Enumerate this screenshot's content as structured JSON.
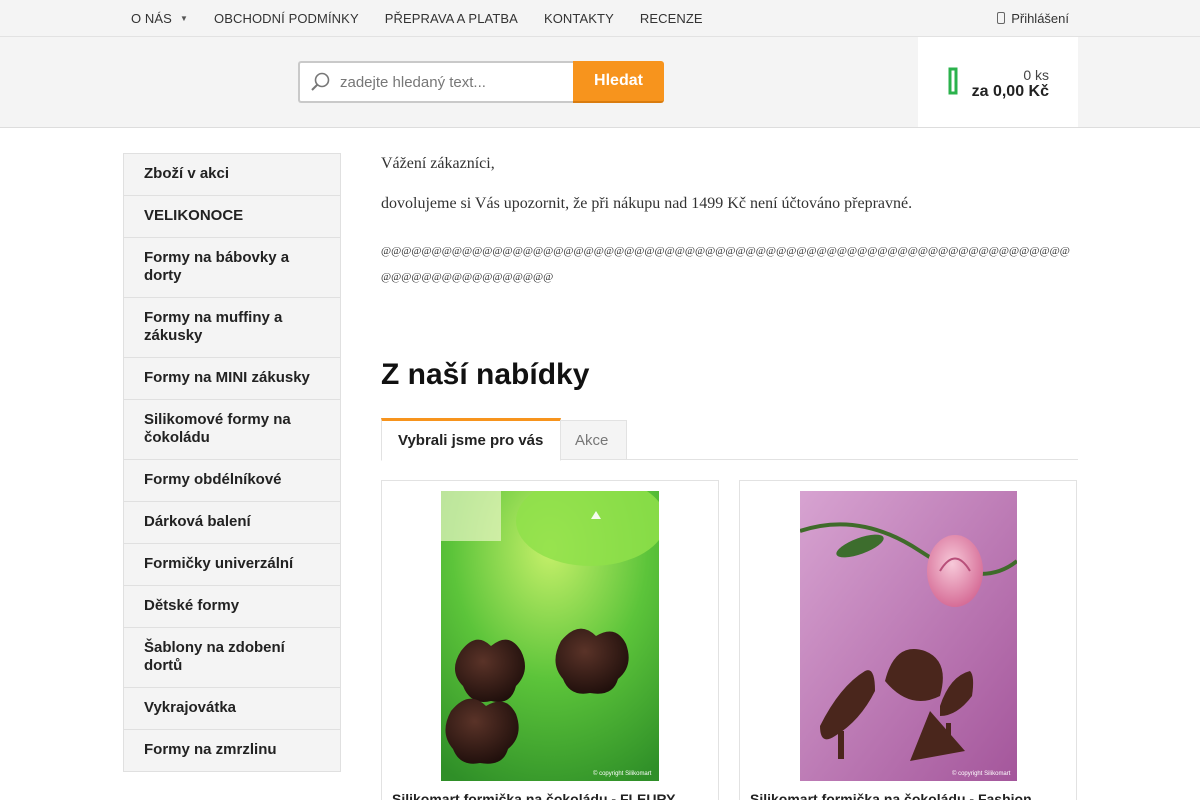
{
  "topnav": {
    "items": [
      {
        "label": "O NÁS",
        "dropdown": true
      },
      {
        "label": "OBCHODNÍ PODMÍNKY"
      },
      {
        "label": "PŘEPRAVA A PLATBA"
      },
      {
        "label": "KONTAKTY"
      },
      {
        "label": "RECENZE"
      }
    ],
    "login_label": "Přihlášení"
  },
  "search": {
    "placeholder": "zadejte hledaný text...",
    "button_label": "Hledat"
  },
  "cart": {
    "quantity": "0 ks",
    "total": "za 0,00 Kč",
    "icon": "cart-icon",
    "accent_color": "#2bb24c"
  },
  "sidebar": {
    "items": [
      "Zboží v akci",
      "VELIKONOCE",
      "Formy na bábovky a dorty",
      "Formy na muffiny a zákusky",
      "Formy na MINI zákusky",
      "Silikomové formy na čokoládu",
      "Formy obdélníkové",
      "Dárková balení",
      "Formičky univerzální",
      "Dětské formy",
      "Šablony na zdobení dortů",
      "Vykrajovátka",
      "Formy na zmrzlinu"
    ]
  },
  "notice": {
    "greeting": "Vážení zákazníci,",
    "text": "dovolujeme si Vás upozornit, že při nákupu nad 1499 Kč není účtováno přepravné.",
    "separator": "@@@@@@@@@@@@@@@@@@@@@@@@@@@@@@@@@@@@@@@@@@@@@@@@@@@@@@@@@@@@@@@@@@@@@@@@@@@@@@@@@@@@@"
  },
  "offer": {
    "title": "Z naší nabídky",
    "tabs": [
      "Vybrali jsme pro vás",
      "Akce"
    ]
  },
  "products": [
    {
      "name": "Silikomart formička na čokoládu - FLEURY",
      "image_copyright": "© copyright Silikomart"
    },
    {
      "name": "Silikomart formička na čokoládu - Fashion",
      "image_copyright": "© copyright Silikomart"
    }
  ],
  "colors": {
    "accent": "#f7941d",
    "cart": "#2bb24c"
  }
}
